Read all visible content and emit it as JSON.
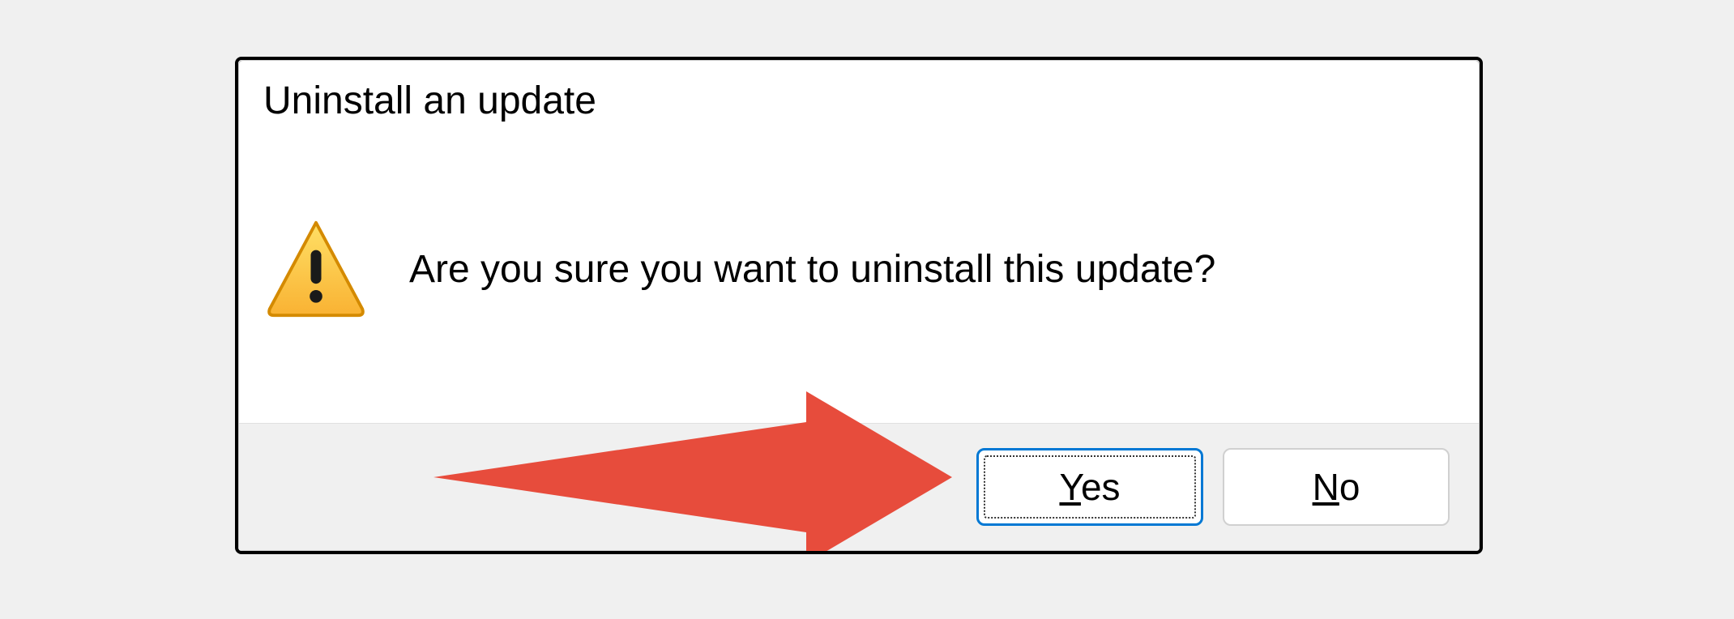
{
  "dialog": {
    "title": "Uninstall an update",
    "message": "Are you sure you want to uninstall this update?",
    "buttons": {
      "yes": {
        "accel": "Y",
        "rest": "es"
      },
      "no": {
        "accel": "N",
        "rest": "o"
      }
    }
  },
  "annotation": {
    "arrow_target": "yes-button",
    "arrow_color": "#e74c3c"
  }
}
